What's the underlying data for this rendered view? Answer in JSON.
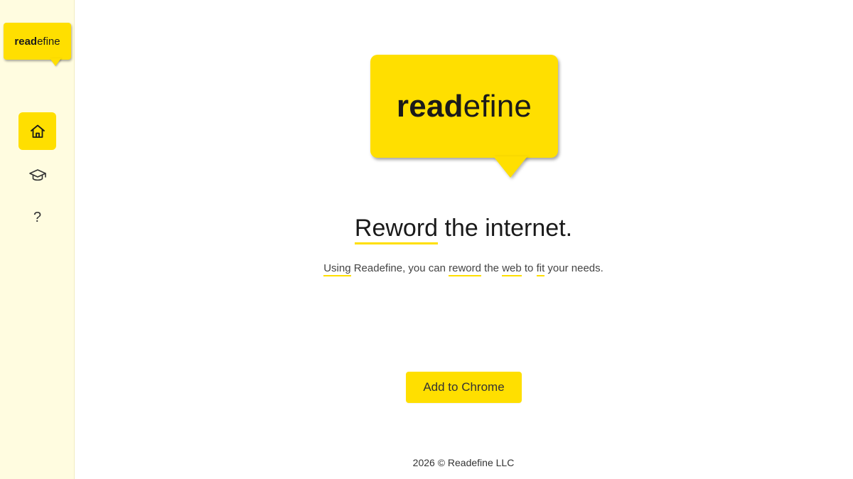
{
  "sidebar": {
    "logo": {
      "part1": "read",
      "part2": "efine"
    },
    "nav": [
      {
        "name": "home",
        "icon": "home-icon",
        "active": true
      },
      {
        "name": "learn",
        "icon": "graduation-cap-icon",
        "active": false
      },
      {
        "name": "help",
        "icon": "question-mark-icon",
        "label": "?",
        "active": false
      }
    ]
  },
  "hero": {
    "logo": {
      "part1": "read",
      "part2": "efine"
    },
    "headline": {
      "word1": "Reword",
      "rest": " the internet."
    },
    "subline": {
      "w1": "Using",
      "t1": " Readefine, you can ",
      "w2": "reword",
      "t2": " the ",
      "w3": "web",
      "t3": " to ",
      "w4": "fit",
      "t4": " your needs."
    },
    "cta_label": "Add to Chrome"
  },
  "footer": {
    "text": "2026 © Readefine LLC"
  },
  "colors": {
    "accent": "#ffdf00",
    "sidebar_bg": "#fffce0"
  }
}
